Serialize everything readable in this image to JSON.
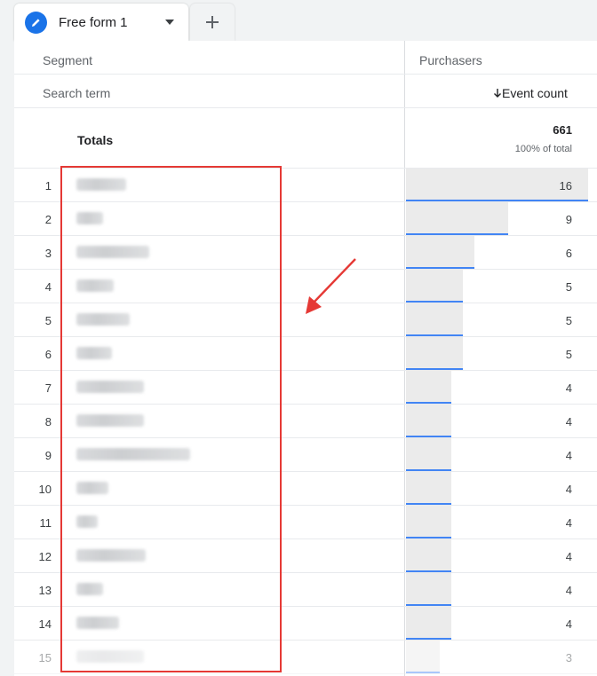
{
  "tabs": {
    "active_label": "Free form 1",
    "add_icon": "plus-icon",
    "active_icon": "pencil-icon"
  },
  "table": {
    "dimension_header": "Segment",
    "dimension_subheader": "Search term",
    "segment_header": "Purchasers",
    "metric_header": "Event count",
    "sort_icon": "arrow-down-icon",
    "totals_label": "Totals",
    "totals_value": "661",
    "totals_pct": "100% of total",
    "rows": [
      {
        "rank": "1",
        "value": "16",
        "bar": 1.0,
        "term_w": 56
      },
      {
        "rank": "2",
        "value": "9",
        "bar": 0.5625,
        "term_w": 30
      },
      {
        "rank": "3",
        "value": "6",
        "bar": 0.375,
        "term_w": 82
      },
      {
        "rank": "4",
        "value": "5",
        "bar": 0.3125,
        "term_w": 42
      },
      {
        "rank": "5",
        "value": "5",
        "bar": 0.3125,
        "term_w": 60
      },
      {
        "rank": "6",
        "value": "5",
        "bar": 0.3125,
        "term_w": 40
      },
      {
        "rank": "7",
        "value": "4",
        "bar": 0.25,
        "term_w": 76
      },
      {
        "rank": "8",
        "value": "4",
        "bar": 0.25,
        "term_w": 76
      },
      {
        "rank": "9",
        "value": "4",
        "bar": 0.25,
        "term_w": 128
      },
      {
        "rank": "10",
        "value": "4",
        "bar": 0.25,
        "term_w": 36
      },
      {
        "rank": "11",
        "value": "4",
        "bar": 0.25,
        "term_w": 24
      },
      {
        "rank": "12",
        "value": "4",
        "bar": 0.25,
        "term_w": 78
      },
      {
        "rank": "13",
        "value": "4",
        "bar": 0.25,
        "term_w": 30
      },
      {
        "rank": "14",
        "value": "4",
        "bar": 0.25,
        "term_w": 48
      },
      {
        "rank": "15",
        "value": "3",
        "bar": 0.1875,
        "term_w": 76
      }
    ]
  },
  "colors": {
    "accent": "#1a73e8",
    "bar_line": "#4285f4",
    "annotation": "#e53935"
  }
}
